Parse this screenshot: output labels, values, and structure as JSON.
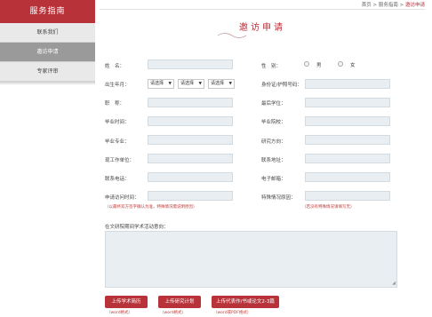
{
  "sidebar": {
    "title": "服务指南",
    "items": [
      {
        "label": "联系我们",
        "active": false
      },
      {
        "label": "邀访申请",
        "active": true
      },
      {
        "label": "专家评审",
        "active": false
      }
    ]
  },
  "breadcrumb": {
    "home": "首页",
    "sep1": " > ",
    "section": "服务指南",
    "sep2": " > ",
    "current": "邀访申请"
  },
  "page_title": "邀访申请",
  "form": {
    "name_label": "姓　名：",
    "gender_label": "性　别：",
    "gender_male": "男",
    "gender_female": "女",
    "birth_label": "出生年月：",
    "select_placeholder": "请选择",
    "id_label": "身份证/护照号码：",
    "title_label": "职　称：",
    "degree_label": "最后学位：",
    "time_label": "毕业时间：",
    "school_label": "毕业院校：",
    "major_label": "毕业专业：",
    "research_label": "研究方向：",
    "unit_label": "现工作单位：",
    "address_label": "联系地址：",
    "phone_label": "联系电话：",
    "email_label": "电子邮箱：",
    "visit_time_label": "申请访问时间：",
    "special_label": "特殊情况原因：",
    "visit_note": "（以最终双方签字确认为准，特殊情况需说明原因）",
    "special_note": "（若没有特殊情况请填写无）",
    "plan_label": "在文研院期间学术活动意向："
  },
  "buttons": {
    "upload_cv": "上传学术简历",
    "upload_plan": "上传研究计划",
    "upload_works": "上传代表作/书或论文2-3篇"
  },
  "hints": {
    "cv": "（word格式）",
    "plan": "（word格式）",
    "works": "（word或PDF格式）"
  },
  "colors": {
    "accent": "#b8323a",
    "input_bg": "#e9eef2"
  }
}
